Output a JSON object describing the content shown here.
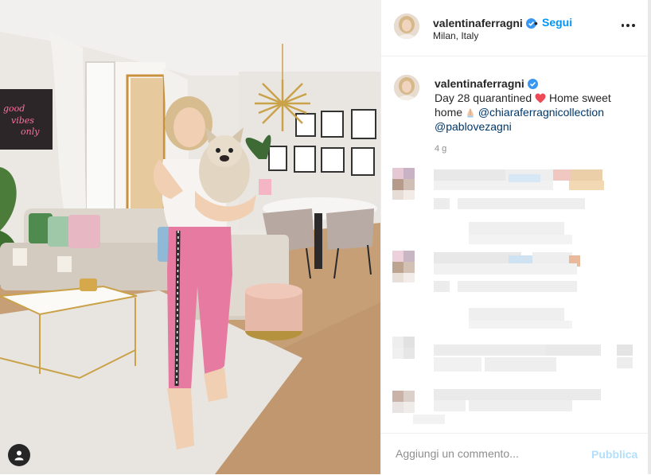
{
  "post": {
    "username": "valentinaferragni",
    "follow_label": "Segui",
    "dot": "•",
    "location": "Milan, Italy",
    "neon_sign": [
      "good",
      "vibes",
      "only"
    ]
  },
  "caption": {
    "username": "valentinaferragni",
    "text_before": "Day 28 quarantined",
    "text_after": " Home sweet home",
    "mention_1": "@chiaraferragnicollection",
    "mention_2": "@pablovezagni",
    "time": "4 g"
  },
  "footer": {
    "placeholder": "Aggiungi un commento...",
    "publish_label": "Pubblica"
  },
  "colors": {
    "accent": "#0095f6",
    "publish_disabled": "#b2dffc",
    "verified": "#3897f0",
    "heart": "#ed4956"
  },
  "icons": [
    "verified-badge-icon",
    "more-options-icon",
    "heart-emoji-icon",
    "user-tag-icon"
  ]
}
